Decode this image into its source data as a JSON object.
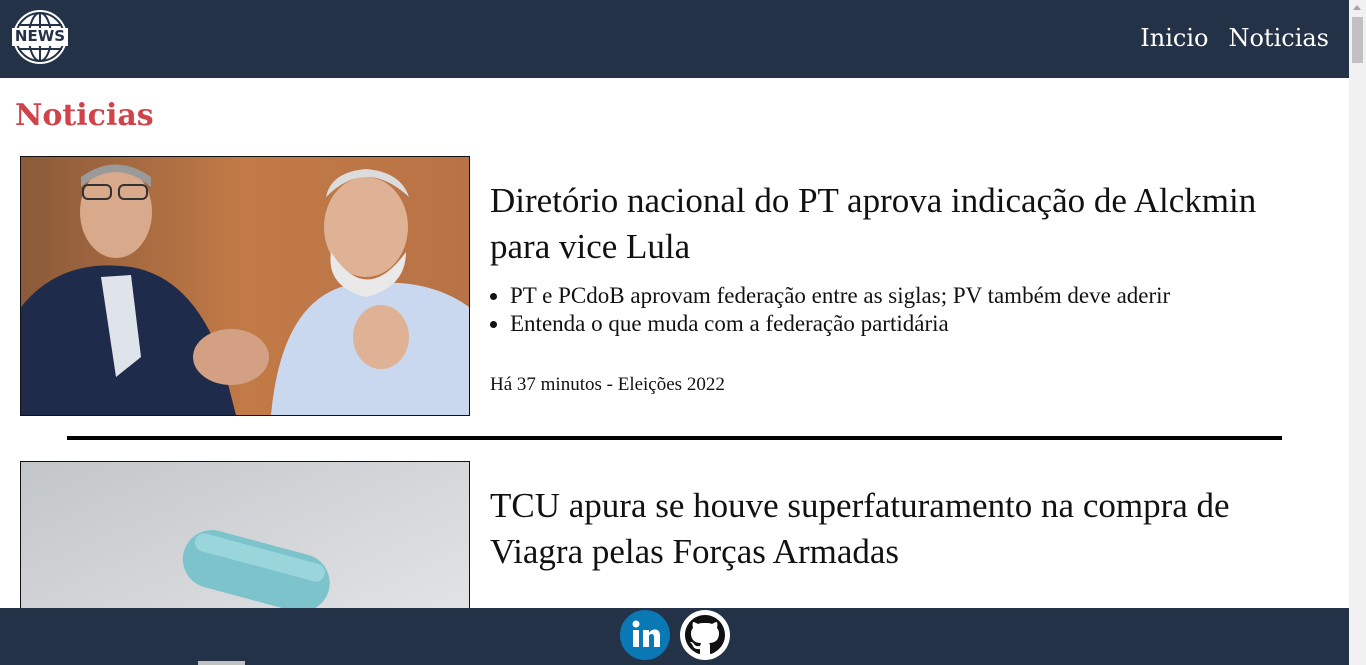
{
  "header": {
    "logo_text": "NEWS",
    "nav": [
      {
        "label": "Inicio"
      },
      {
        "label": "Noticias"
      }
    ]
  },
  "section_title": "Noticias",
  "articles": [
    {
      "title": "Diretório nacional do PT aprova indicação de Alckmin para vice Lula",
      "bullets": [
        "PT e PCdoB aprovam federação entre as siglas; PV também deve aderir",
        "Entenda o que muda com a federação partidária"
      ],
      "meta": "Há 37 minutos - Eleições 2022"
    },
    {
      "title": "TCU apura se houve superfaturamento na compra de Viagra pelas Forças Armadas"
    }
  ],
  "footer": {
    "icons": [
      "linkedin-icon",
      "github-icon"
    ]
  },
  "colors": {
    "header_bg": "#243247",
    "accent": "#d0434a"
  }
}
